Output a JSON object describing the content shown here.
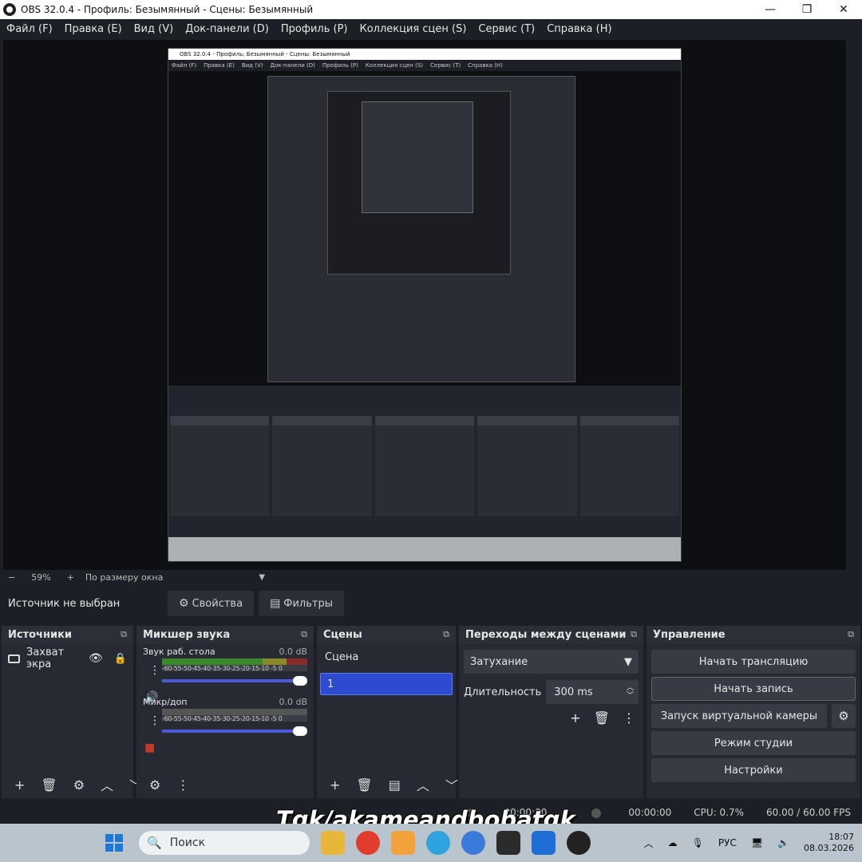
{
  "window": {
    "title": "OBS 32.0.4 - Профиль: Безымянный - Сцены: Безымянный",
    "minimize": "—",
    "maximize": "❐",
    "close": "✕"
  },
  "menu": [
    "Файл (F)",
    "Правка (E)",
    "Вид (V)",
    "Док-панели (D)",
    "Профиль (P)",
    "Коллекция сцен (S)",
    "Сервис (T)",
    "Справка (H)"
  ],
  "zoom": {
    "minus": "−",
    "percent": "59%",
    "plus": "+",
    "fit": "По размеру окна"
  },
  "source_bar": {
    "no_source": "Источник не выбран",
    "properties": "Свойства",
    "filters": "Фильтры"
  },
  "sources": {
    "title": "Источники",
    "items": [
      {
        "label": "Захват экра"
      }
    ]
  },
  "mixer": {
    "title": "Микшер звука",
    "scale": "-60-55-50-45-40-35-30-25-20-15-10 -5 0",
    "channels": [
      {
        "name": "Звук раб. стола",
        "db": "0.0 dB"
      },
      {
        "name": "Микр/доп",
        "db": "0.0 dB"
      }
    ]
  },
  "scenes": {
    "title": "Сцены",
    "header": "Сцена",
    "items": [
      "1"
    ]
  },
  "transitions": {
    "title": "Переходы между сценами",
    "selected": "Затухание",
    "duration_label": "Длительность",
    "duration_value": "300 ms"
  },
  "controls": {
    "title": "Управление",
    "start_stream": "Начать трансляцию",
    "start_record": "Начать запись",
    "virtual_cam": "Запуск виртуальной камеры",
    "studio_mode": "Режим студии",
    "settings": "Настройки"
  },
  "status": {
    "stream_time": "00:00:00",
    "record_time": "00:00:00",
    "cpu": "CPU: 0.7%",
    "fps": "60.00 / 60.00 FPS"
  },
  "watermark": "Tgk/akameandbobatgk",
  "taskbar": {
    "search_placeholder": "Поиск",
    "lang": "РУС",
    "time": "18:07",
    "date": "08.03.2026"
  },
  "colors": {
    "accent": "#2e4ad0",
    "panel": "#272a33",
    "background": "#1d1f26"
  }
}
